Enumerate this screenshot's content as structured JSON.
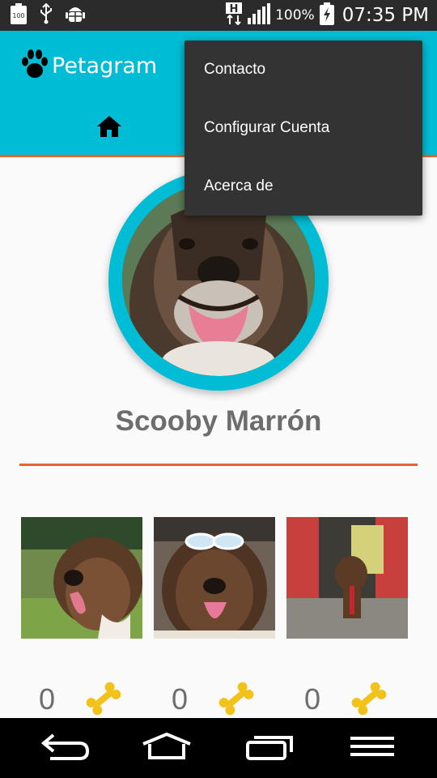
{
  "status_bar": {
    "battery_small_label": "100",
    "battery_percent": "100%",
    "time": "07:35 PM",
    "network_label": "H",
    "icons": [
      "battery-100-icon",
      "usb-icon",
      "android-debug-icon",
      "network-h-icon",
      "signal-icon",
      "battery-charging-icon"
    ]
  },
  "app_bar": {
    "title": "Petagram",
    "logo_icon": "paw-icon",
    "tab_icon": "home-icon",
    "background": "#00bcd4",
    "accent": "#e5642e"
  },
  "menu": {
    "items": [
      {
        "label": "Contacto"
      },
      {
        "label": "Configurar Cuenta"
      },
      {
        "label": "Acerca de"
      }
    ]
  },
  "profile": {
    "name": "Scooby Marrón",
    "ring_color": "#00bcd4"
  },
  "gallery": {
    "items": [
      {
        "likes": "0",
        "icon": "bone-icon"
      },
      {
        "likes": "0",
        "icon": "bone-icon"
      },
      {
        "likes": "0",
        "icon": "bone-icon"
      }
    ]
  },
  "nav_bar": {
    "icons": [
      "back-icon",
      "home-nav-icon",
      "recents-icon",
      "menu-icon"
    ]
  }
}
